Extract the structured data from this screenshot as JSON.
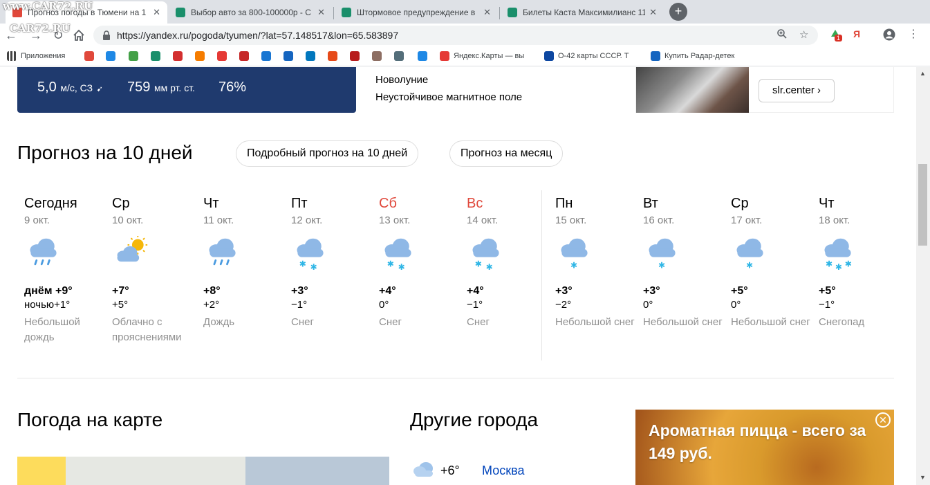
{
  "watermark": "www.CAR72.RU",
  "watermark2": "CAR72.RU",
  "tabs": [
    {
      "title": "Прогноз погоды в Тюмени на 1",
      "color": "#e0483b"
    },
    {
      "title": "Выбор авто за 800-100000р - С",
      "color": "#1a8f6b"
    },
    {
      "title": "Штормовое предупреждение в",
      "color": "#1a8f6b"
    },
    {
      "title": "Билеты Каста Максимилианс 11",
      "color": "#1a8f6b"
    }
  ],
  "address_bar": {
    "url": "https://yandex.ru/pogoda/tyumen/?lat=57.148517&lon=65.583897"
  },
  "extensions": {
    "badge": "1"
  },
  "bookmarks": [
    {
      "label": "Приложения",
      "color": "#444"
    },
    {
      "label": "",
      "color": "#e0483b"
    },
    {
      "label": "",
      "color": "#1e88e5"
    },
    {
      "label": "",
      "color": "#43a047"
    },
    {
      "label": "",
      "color": "#1a8f6b"
    },
    {
      "label": "",
      "color": "#d32f2f"
    },
    {
      "label": "",
      "color": "#f57c00"
    },
    {
      "label": "",
      "color": "#e53935"
    },
    {
      "label": "",
      "color": "#c62828"
    },
    {
      "label": "",
      "color": "#1976d2"
    },
    {
      "label": "",
      "color": "#1565c0"
    },
    {
      "label": "",
      "color": "#0277bd"
    },
    {
      "label": "",
      "color": "#e64a19"
    },
    {
      "label": "",
      "color": "#b71c1c"
    },
    {
      "label": "",
      "color": "#8d6e63"
    },
    {
      "label": "",
      "color": "#546e7a"
    },
    {
      "label": "",
      "color": "#1e88e5"
    },
    {
      "label": "Яндекс.Карты — вы",
      "color": "#e53935"
    },
    {
      "label": "О-42 карты СССР. Т",
      "color": "#0d47a1"
    },
    {
      "label": "Купить Радар-детек",
      "color": "#1565c0"
    }
  ],
  "current": {
    "wind_value": "5,0",
    "wind_unit": "м/с, СЗ",
    "pressure_value": "759",
    "pressure_unit": "мм рт. ст.",
    "humidity": "76%"
  },
  "moon": {
    "phase": "Новолуние",
    "magnetic": "Неустойчивое магнитное поле"
  },
  "ad_top": {
    "button": "slr.center"
  },
  "forecast": {
    "title": "Прогноз на 10 дней",
    "btn_detailed": "Подробный прогноз на 10 дней",
    "btn_month": "Прогноз на месяц",
    "days": [
      {
        "name": "Сегодня",
        "date": "9 окт.",
        "hi": "днём +9°",
        "lo": "ночью+1°",
        "cond": "Небольшой дождь",
        "icon": "rain-icon",
        "weekend": false
      },
      {
        "name": "Ср",
        "date": "10 окт.",
        "hi": "+7°",
        "lo": "+5°",
        "cond": "Облачно с прояснениями",
        "icon": "partly-cloudy-icon",
        "weekend": false
      },
      {
        "name": "Чт",
        "date": "11 окт.",
        "hi": "+8°",
        "lo": "+2°",
        "cond": "Дождь",
        "icon": "rain-icon",
        "weekend": false
      },
      {
        "name": "Пт",
        "date": "12 окт.",
        "hi": "+3°",
        "lo": "−1°",
        "cond": "Снег",
        "icon": "snow-icon",
        "weekend": false
      },
      {
        "name": "Сб",
        "date": "13 окт.",
        "hi": "+4°",
        "lo": "0°",
        "cond": "Снег",
        "icon": "snow-icon",
        "weekend": true
      },
      {
        "name": "Вс",
        "date": "14 окт.",
        "hi": "+4°",
        "lo": "−1°",
        "cond": "Снег",
        "icon": "snow-icon",
        "weekend": true
      },
      {
        "name": "Пн",
        "date": "15 окт.",
        "hi": "+3°",
        "lo": "−2°",
        "cond": "Небольшой снег",
        "icon": "light-snow-icon",
        "weekend": false
      },
      {
        "name": "Вт",
        "date": "16 окт.",
        "hi": "+3°",
        "lo": "0°",
        "cond": "Небольшой снег",
        "icon": "light-snow-icon",
        "weekend": false
      },
      {
        "name": "Ср",
        "date": "17 окт.",
        "hi": "+5°",
        "lo": "0°",
        "cond": "Небольшой снег",
        "icon": "light-snow-icon",
        "weekend": false
      },
      {
        "name": "Чт",
        "date": "18 окт.",
        "hi": "+5°",
        "lo": "−1°",
        "cond": "Снегопад",
        "icon": "heavy-snow-icon",
        "weekend": false
      }
    ]
  },
  "map_section": {
    "title": "Погода на карте"
  },
  "other_cities": {
    "title": "Другие города",
    "items": [
      {
        "temp": "+6°",
        "city": "Москва"
      }
    ]
  },
  "ad_pizza": {
    "text": "Ароматная пицца - всего за 149 руб."
  }
}
